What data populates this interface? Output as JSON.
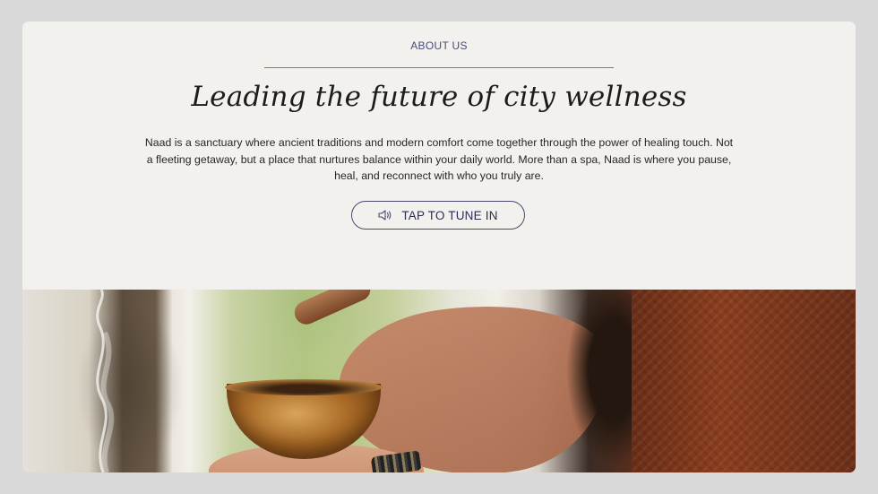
{
  "section": {
    "eyebrow": "ABOUT US",
    "headline": "Leading the future of city wellness",
    "body": "Naad is a sanctuary where ancient traditions and modern comfort come together through the power of healing touch. Not a fleeting getaway, but a place that nurtures balance within your daily world. More than a spa, Naad is where you pause, heal, and reconnect with who you truly are.",
    "cta": {
      "label": "TAP TO TUNE IN",
      "icon": "speaker-icon"
    }
  },
  "colors": {
    "page_bg": "#d9d9d9",
    "card_bg": "#f2f1ed",
    "accent": "#4b4a6e",
    "headline": "#1c1c1c"
  },
  "image": {
    "subject": "singing-bowl-photo"
  }
}
